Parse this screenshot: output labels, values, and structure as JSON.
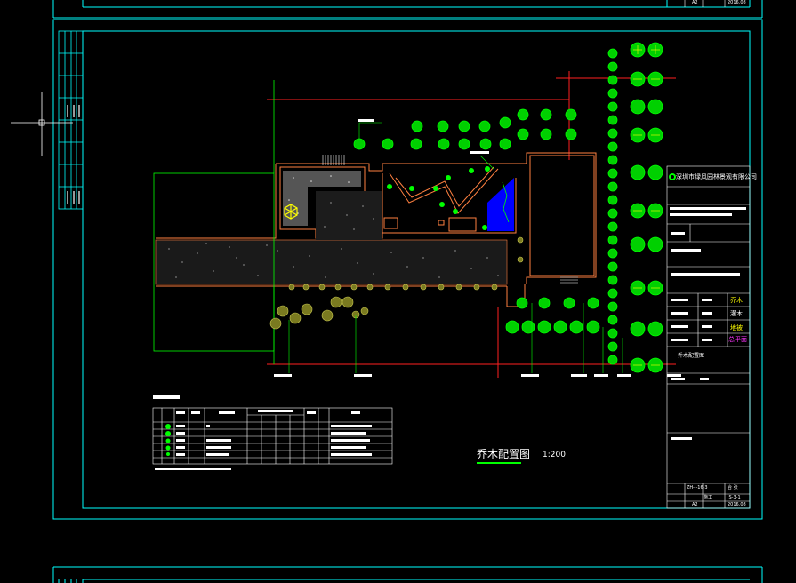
{
  "drawing": {
    "title": "乔木配置图",
    "scale": "1:200",
    "company_name": "深圳市绿风园林景观有限公司",
    "drawing_name": "乔木配置图",
    "sheet_size_top": "A2",
    "date_top": "2016.08",
    "sheet_code": "ZH-Ⅰ-16-3",
    "sheet_number": "JS-3-1",
    "sheet_size": "A2",
    "date": "2016.08",
    "stage_label": "施工",
    "page_label": "合 张"
  },
  "title_block": {
    "stamps": [
      "乔木",
      "灌木",
      "地被",
      "总平面"
    ]
  },
  "colors": {
    "frame": "#00ffff",
    "trees": "#00ff00",
    "hardscape": "#ff8040",
    "paving": "#cccccc",
    "water": "#0000ff",
    "magenta": "#ff33ff",
    "yellow": "#ffff00"
  },
  "icons": {
    "crosshair": "cad-crosshair-cursor",
    "tree": "tree-canopy-symbol"
  }
}
